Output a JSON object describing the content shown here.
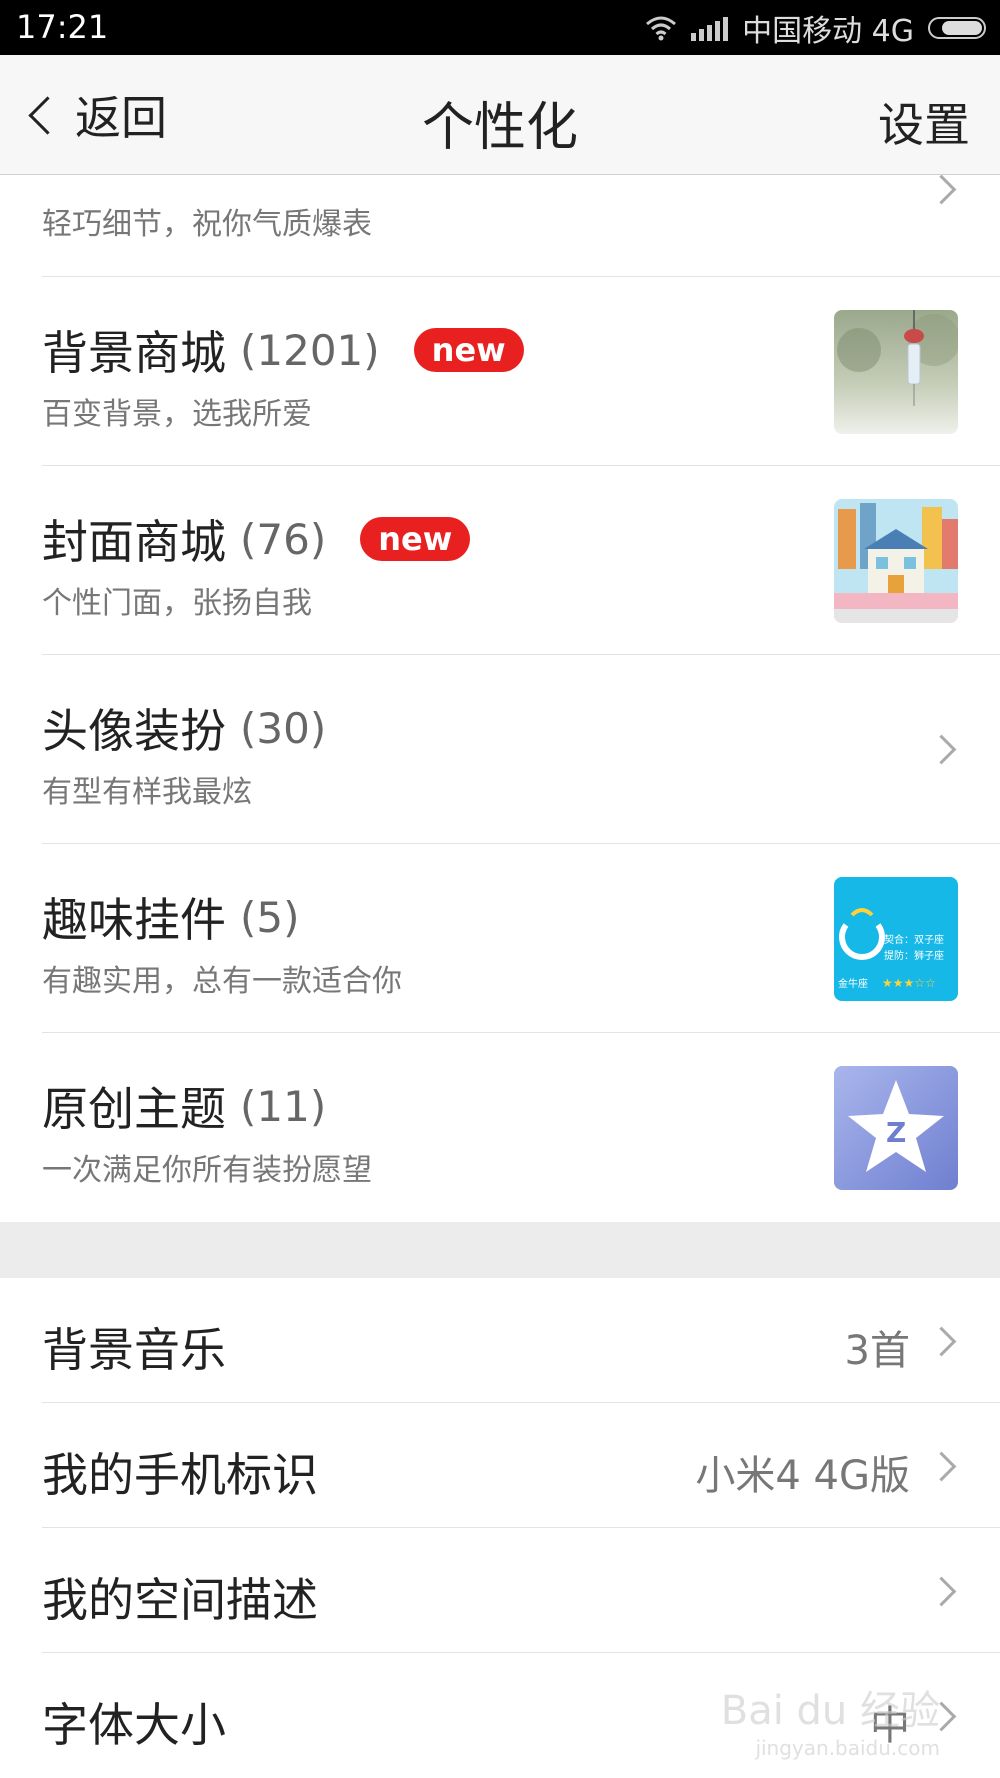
{
  "status_bar": {
    "time": "17:21",
    "carrier": "中国移动 4G",
    "battery_level": 0.8
  },
  "nav": {
    "back_label": "返回",
    "title": "个性化",
    "settings_label": "设置"
  },
  "store_items": [
    {
      "subtitle": "轻巧细节，祝你气质爆表"
    },
    {
      "title": "背景商城",
      "count": "(1201)",
      "badge": "new",
      "subtitle": "百变背景，选我所爱"
    },
    {
      "title": "封面商城",
      "count": "(76)",
      "badge": "new",
      "subtitle": "个性门面，张扬自我"
    },
    {
      "title": "头像装扮",
      "count": "(30)",
      "subtitle": "有型有样我最炫"
    },
    {
      "title": "趣味挂件",
      "count": "(5)",
      "subtitle": "有趣实用，总有一款适合你"
    },
    {
      "title": "原创主题",
      "count": "(11)",
      "subtitle": "一次满足你所有装扮愿望"
    }
  ],
  "pendant_thumb": {
    "line1": "契合：双子座",
    "line2": "提防：狮子座",
    "sign": "金牛座",
    "stars": "★★★☆☆"
  },
  "settings_items": [
    {
      "title": "背景音乐",
      "value": "3首"
    },
    {
      "title": "我的手机标识",
      "value": "小米4 4G版"
    },
    {
      "title": "我的空间描述",
      "value": ""
    },
    {
      "title": "字体大小",
      "value": "中"
    }
  ],
  "watermark": {
    "text": "Bai du 经验",
    "url": "jingyan.baidu.com"
  },
  "colors": {
    "badge": "#e8201f",
    "nav_bg": "#f7f7f7",
    "status_bg": "#000000",
    "separator": "#ececec"
  }
}
